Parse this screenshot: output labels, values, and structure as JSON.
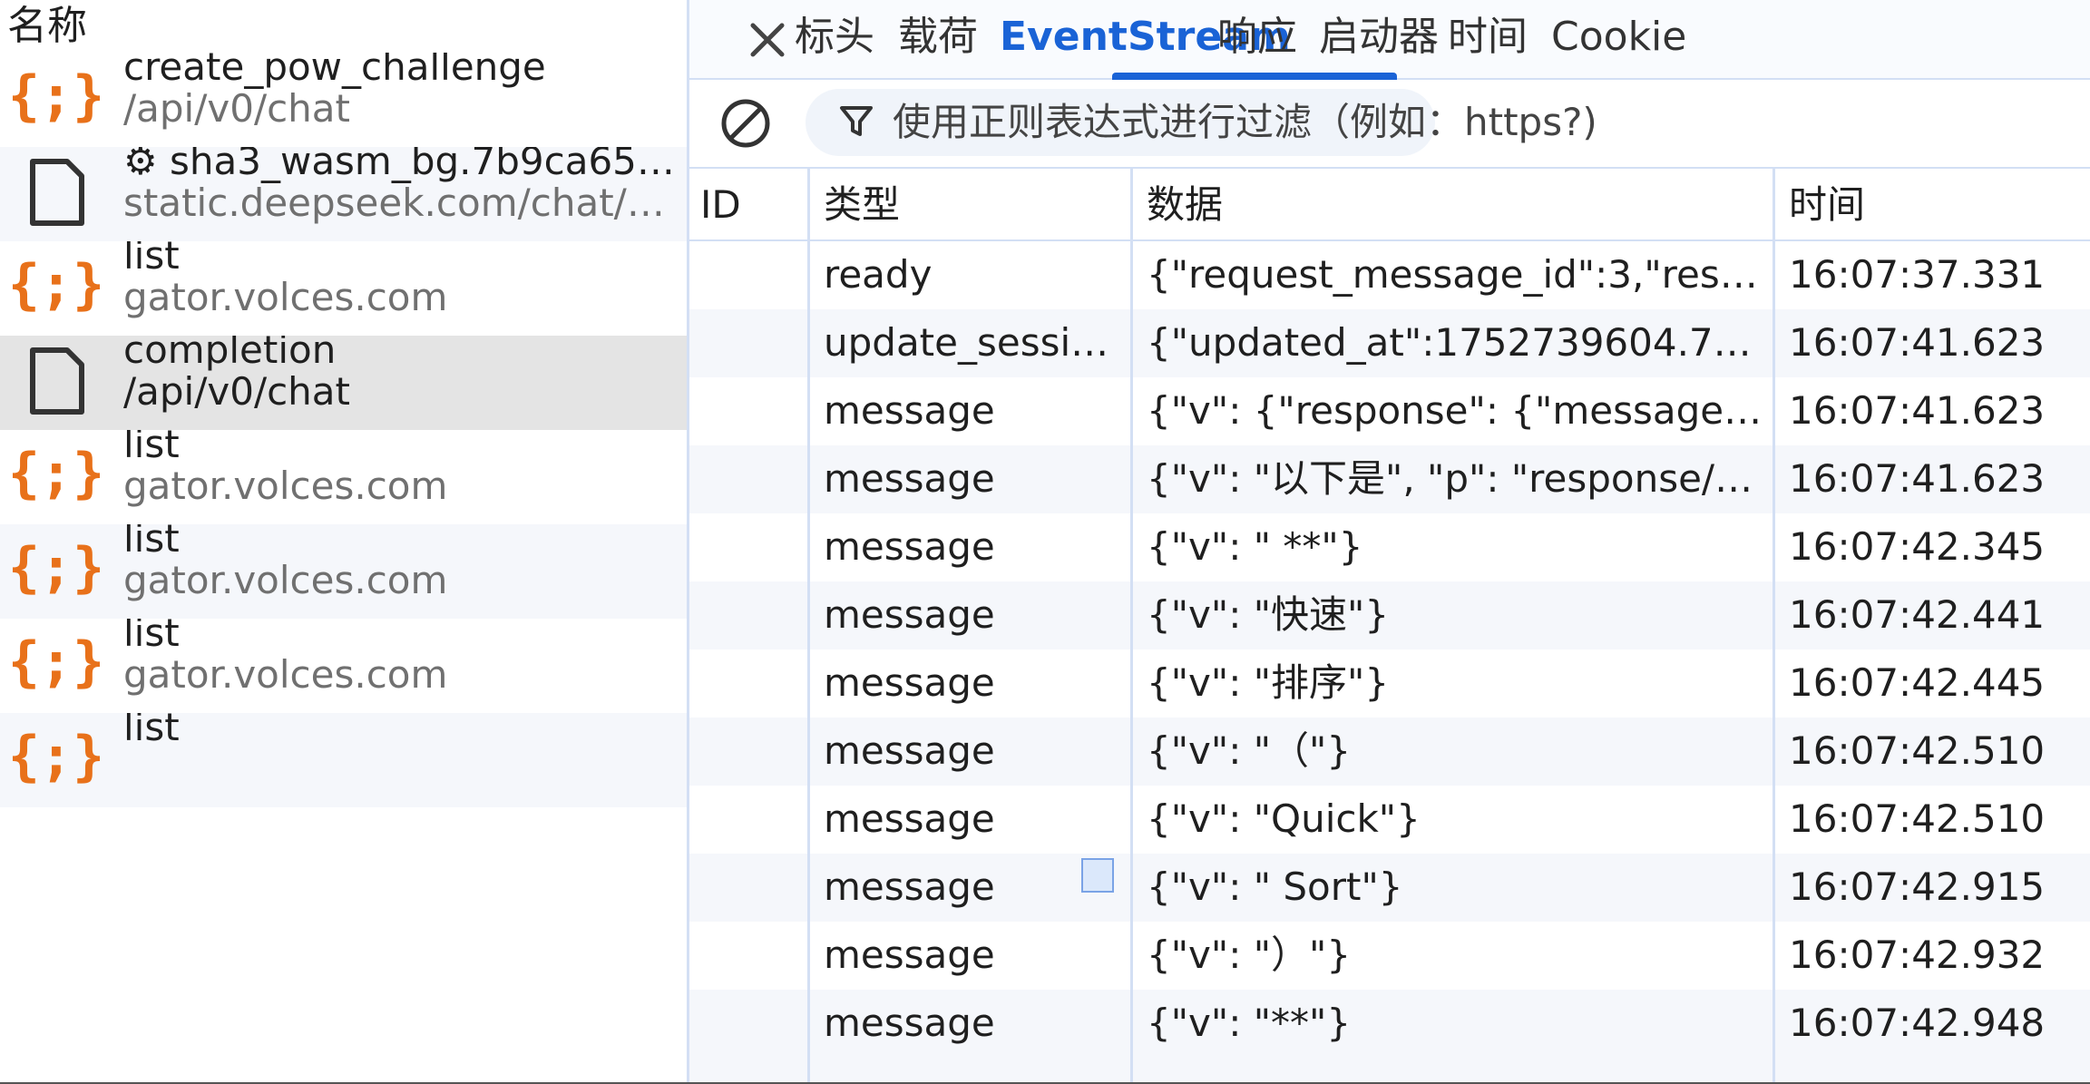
{
  "colors": {
    "accent": "#1a63d6",
    "json_icon": "#e8711a",
    "divider": "#d3dff4",
    "selected_row": "#e4e4e4"
  },
  "request_list": {
    "header": "名称",
    "items": [
      {
        "name": "create_pow_challenge",
        "sub": "/api/v0/chat",
        "icon": "json-icon",
        "selected": false
      },
      {
        "name": "⚙ sha3_wasm_bg.7b9ca65…",
        "sub": "static.deepseek.com/chat/…",
        "icon": "document-icon",
        "selected": false
      },
      {
        "name": "list",
        "sub": "gator.volces.com",
        "icon": "json-icon",
        "selected": false
      },
      {
        "name": "completion",
        "sub": "/api/v0/chat",
        "icon": "document-icon",
        "selected": true
      },
      {
        "name": "list",
        "sub": "gator.volces.com",
        "icon": "json-icon",
        "selected": false
      },
      {
        "name": "list",
        "sub": "gator.volces.com",
        "icon": "json-icon",
        "selected": false
      },
      {
        "name": "list",
        "sub": "gator.volces.com",
        "icon": "json-icon",
        "selected": false
      },
      {
        "name": "list",
        "sub": "",
        "icon": "json-icon",
        "selected": false
      }
    ]
  },
  "tabs": [
    {
      "label": "标头",
      "active": false
    },
    {
      "label": "载荷",
      "active": false
    },
    {
      "label": "EventStream",
      "active": true
    },
    {
      "label": "响应",
      "active": false
    },
    {
      "label": "启动器",
      "active": false
    },
    {
      "label": "时间",
      "active": false
    },
    {
      "label": "Cookie",
      "active": false
    }
  ],
  "filter": {
    "placeholder": "使用正则表达式进行过滤（例如：https?)"
  },
  "table": {
    "headers": [
      "ID",
      "类型",
      "数据",
      "时间"
    ],
    "rows": [
      {
        "id": "",
        "type": "ready",
        "data": "{\"request_message_id\":3,\"res…",
        "time": "16:07:37.331"
      },
      {
        "id": "",
        "type": "update_sessi…",
        "data": "{\"updated_at\":1752739604.7…",
        "time": "16:07:41.623"
      },
      {
        "id": "",
        "type": "message",
        "data": "{\"v\": {\"response\": {\"message…",
        "time": "16:07:41.623"
      },
      {
        "id": "",
        "type": "message",
        "data": "{\"v\": \"以下是\", \"p\": \"response/…",
        "time": "16:07:41.623"
      },
      {
        "id": "",
        "type": "message",
        "data": "{\"v\": \" **\"}",
        "time": "16:07:42.345"
      },
      {
        "id": "",
        "type": "message",
        "data": "{\"v\": \"快速\"}",
        "time": "16:07:42.441"
      },
      {
        "id": "",
        "type": "message",
        "data": "{\"v\": \"排序\"}",
        "time": "16:07:42.445"
      },
      {
        "id": "",
        "type": "message",
        "data": "{\"v\": \"（\"}",
        "time": "16:07:42.510"
      },
      {
        "id": "",
        "type": "message",
        "data": "{\"v\": \"Quick\"}",
        "time": "16:07:42.510"
      },
      {
        "id": "",
        "type": "message",
        "data": "{\"v\": \" Sort\"}",
        "time": "16:07:42.915"
      },
      {
        "id": "",
        "type": "message",
        "data": "{\"v\": \"）\"}",
        "time": "16:07:42.932"
      },
      {
        "id": "",
        "type": "message",
        "data": "{\"v\": \"**\"}",
        "time": "16:07:42.948"
      }
    ]
  }
}
